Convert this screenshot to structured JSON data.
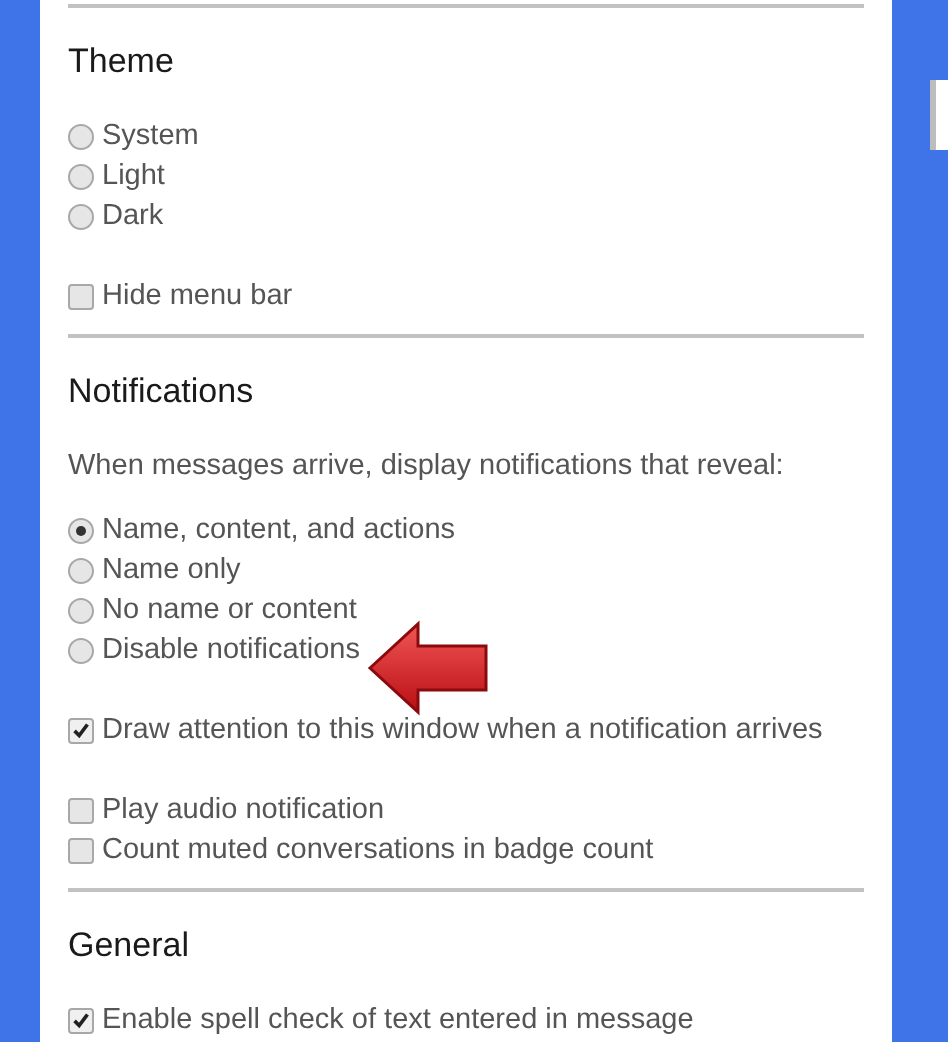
{
  "sections": [
    {
      "title": "Theme",
      "groups": [
        {
          "kind": "radio",
          "options": [
            {
              "label": "System",
              "selected": false
            },
            {
              "label": "Light",
              "selected": false
            },
            {
              "label": "Dark",
              "selected": false
            }
          ]
        },
        {
          "kind": "checkbox",
          "options": [
            {
              "label": "Hide menu bar",
              "checked": false
            }
          ]
        }
      ]
    },
    {
      "title": "Notifications",
      "description": "When messages arrive, display notifications that reveal:",
      "groups": [
        {
          "kind": "radio",
          "options": [
            {
              "label": "Name, content, and actions",
              "selected": true
            },
            {
              "label": "Name only",
              "selected": false
            },
            {
              "label": "No name or content",
              "selected": false
            },
            {
              "label": "Disable notifications",
              "selected": false
            }
          ]
        },
        {
          "kind": "checkbox",
          "options": [
            {
              "label": "Draw attention to this window when a notification arrives",
              "checked": true
            }
          ]
        },
        {
          "kind": "checkbox",
          "options": [
            {
              "label": "Play audio notification",
              "checked": false
            },
            {
              "label": "Count muted conversations in badge count",
              "checked": false
            }
          ]
        }
      ]
    },
    {
      "title": "General",
      "groups": [
        {
          "kind": "checkbox",
          "options": [
            {
              "label": "Enable spell check of text entered in message",
              "checked": true
            }
          ]
        }
      ]
    }
  ]
}
